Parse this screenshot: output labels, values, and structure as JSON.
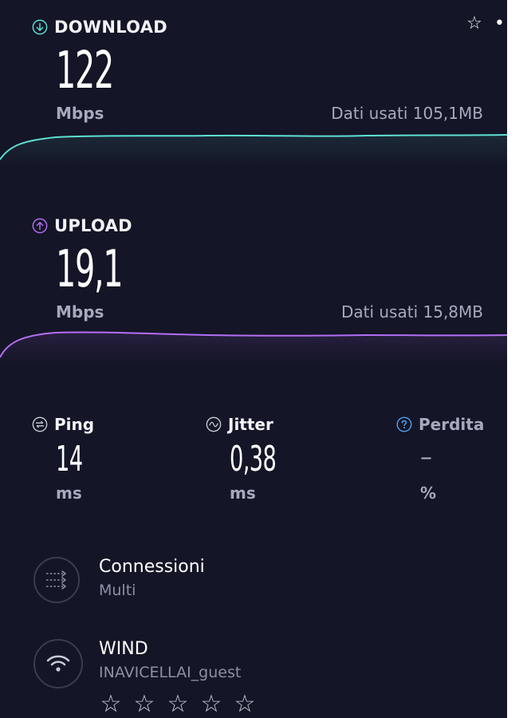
{
  "header": {
    "star_icon": "star-outline-icon",
    "more_icon": "more-dots-icon",
    "star_glyph": "☆",
    "more_glyph": "•••"
  },
  "download": {
    "label": "DOWNLOAD",
    "value": "122",
    "unit": "Mbps",
    "data_used": "Dati usati 105,1MB",
    "color": "#5ee0d4"
  },
  "upload": {
    "label": "UPLOAD",
    "value": "19,1",
    "unit": "Mbps",
    "data_used": "Dati usati 15,8MB",
    "color": "#b46ef5"
  },
  "metrics": {
    "ping": {
      "label": "Ping",
      "value": "14",
      "unit": "ms"
    },
    "jitter": {
      "label": "Jitter",
      "value": "0,38",
      "unit": "ms"
    },
    "loss": {
      "label": "Perdita",
      "value": "–",
      "unit": "%",
      "color": "#52a8ff"
    }
  },
  "connections": {
    "title": "Connessioni",
    "subtitle": "Multi"
  },
  "network": {
    "title": "WIND",
    "subtitle": "INAVICELLAI_guest",
    "rating_glyph": "☆",
    "rating_max": 5
  }
}
